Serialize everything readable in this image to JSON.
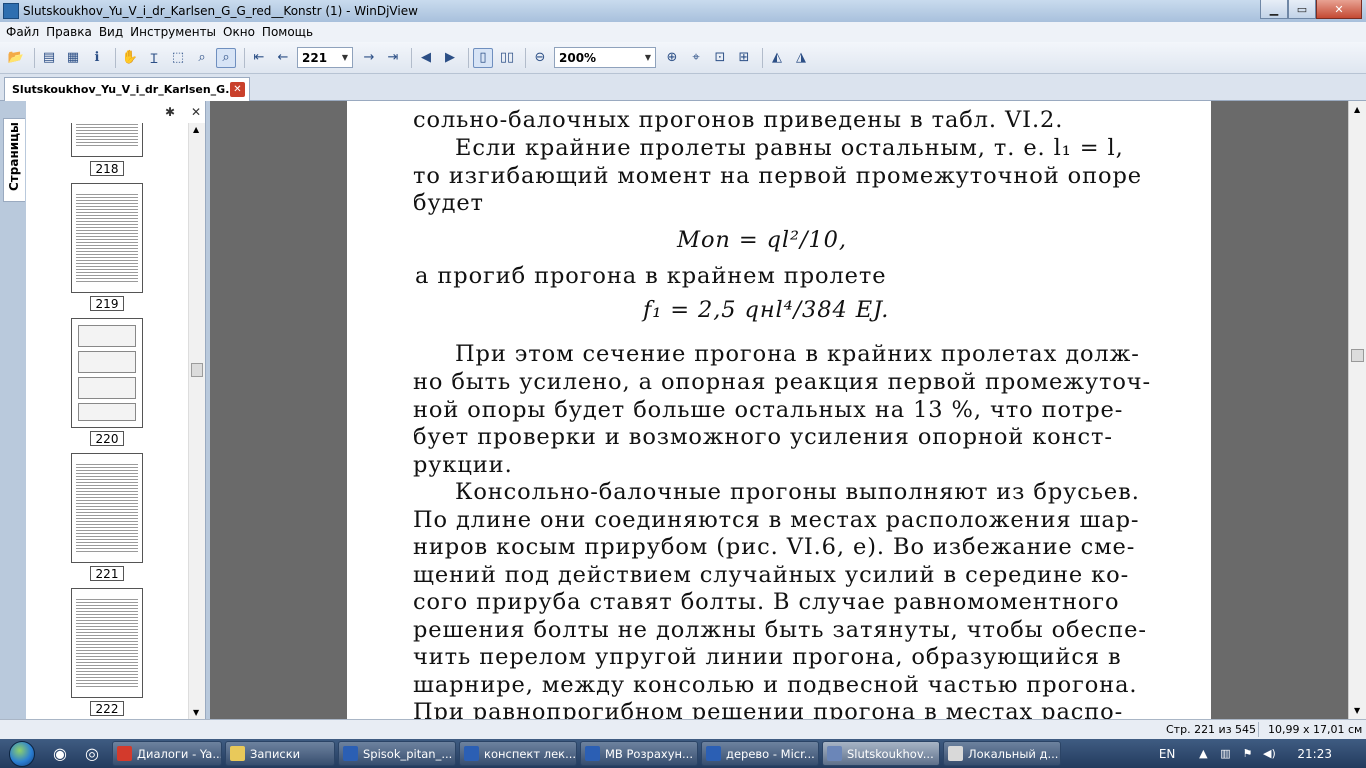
{
  "window": {
    "title": "Slutskoukhov_Yu_V_i_dr_Karlsen_G_G_red__Konstr (1) - WinDjView",
    "minimize": "▁",
    "maximize": "▭",
    "close": "✕"
  },
  "menu": [
    "Файл",
    "Правка",
    "Вид",
    "Инструменты",
    "Окно",
    "Помощь"
  ],
  "toolbar": {
    "page_value": "221",
    "zoom_value": "200%",
    "icons": [
      "open-icon",
      "print-icon",
      "print-preview-icon",
      "info-icon",
      "hand-tool-icon",
      "text-select-icon",
      "rect-select-icon",
      "zoom-tool-icon",
      "magnifier-icon",
      "first-page-icon",
      "prev-page-icon",
      "next-page-icon",
      "last-page-icon",
      "back-icon",
      "forward-icon",
      "single-page-icon",
      "two-pages-icon",
      "zoom-out-icon",
      "zoom-in-icon",
      "fit-page-icon",
      "fit-width-icon",
      "actual-size-icon",
      "rotate-left-icon",
      "rotate-right-icon"
    ]
  },
  "tab": {
    "label": "Slutskoukhov_Yu_V_i_dr_Karlsen_G...",
    "close": "✕"
  },
  "sidebar": {
    "tab_label": "Страницы",
    "gear": "✱",
    "close": "✕",
    "thumbnails": [
      "218",
      "219",
      "220",
      "221",
      "222"
    ]
  },
  "page_text": {
    "line1": "сольно-балочных  прогонов  приведены  в  табл.  VI.2.",
    "line2": "Если крайние пролеты равны   остальным,  т.  е.  l₁ = l,",
    "line3": "то изгибающий момент на первой промежуточной опоре",
    "line4": "будет",
    "eq1": "Mоп = ql²/10,",
    "line5": "а прогиб прогона в крайнем пролете",
    "eq2": "f₁ = 2,5 qнl⁴/384 EJ.",
    "line6": "При этом сечение прогона в крайних пролетах долж-",
    "line7": "но быть усилено, а опорная реакция первой промежуточ-",
    "line8": "ной опоры будет больше остальных на 13 %, что потре-",
    "line9": "бует проверки и возможного усиления опорной  конст-",
    "line10": "рукции.",
    "line11": "Консольно-балочные прогоны выполняют из брусьев.",
    "line12": "По длине они соединяются в местах расположения шар-",
    "line13": "ниров косым прирубом  (рис. VI.6, е). Во избежание сме-",
    "line14": "щений под действием случайных усилий в середине ко-",
    "line15": "сого прируба ставят болты. В случае  равномоментного",
    "line16": "решения болты не должны быть затянуты, чтобы обеспе-",
    "line17": "чить перелом упругой линии прогона, образующийся  в",
    "line18": "шарнире, между консолью и подвесной частью прогона.",
    "line19": "При равнопрогибном решении прогона в местах распо-"
  },
  "status": {
    "page_info": "Стр. 221 из 545",
    "page_size": "10,99 x 17,01 см"
  },
  "taskbar": {
    "tasks": [
      {
        "label": "Диалоги - Ya...",
        "color": "#d33a2c"
      },
      {
        "label": "Записки",
        "color": "#e9c95a"
      },
      {
        "label": "Spisok_pitan_...",
        "color": "#2b5fb4"
      },
      {
        "label": "конспект лек...",
        "color": "#2b5fb4"
      },
      {
        "label": "МВ Розрахун...",
        "color": "#2b5fb4"
      },
      {
        "label": "дерево - Micr...",
        "color": "#2b5fb4"
      },
      {
        "label": "Slutskoukhov...",
        "color": "#6b86b8"
      },
      {
        "label": "Локальный д...",
        "color": "#d9d9d9"
      }
    ],
    "lang": "EN",
    "clock": "21:23"
  }
}
